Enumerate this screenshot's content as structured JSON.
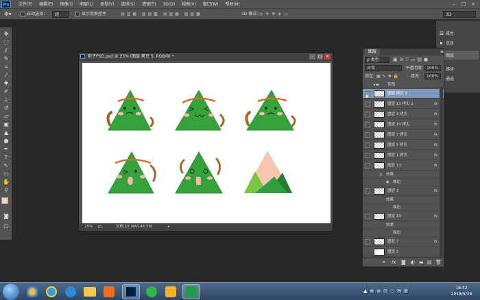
{
  "menubar": {
    "app_logo": "Ps",
    "menus": [
      "文件(F)",
      "编辑(E)",
      "图像(I)",
      "图层(L)",
      "类型(Y)",
      "选择(S)",
      "滤镜(T)",
      "3D(D)",
      "视图(V)",
      "窗口(W)",
      "帮助(H)"
    ]
  },
  "options": {
    "auto_select_label": "自动选择：",
    "auto_select_value": "组",
    "show_transform_label": "显示变换控件",
    "mode_3d_label": "3D 模式：",
    "workspace": "3D"
  },
  "document": {
    "title": "粽子PSD.psd @ 25% (图层 拷贝 5, RGB/8) *",
    "zoom": "25%",
    "doc_info": "文档:16.9M/146.5M"
  },
  "right_panel": {
    "items": [
      {
        "icon": "properties-icon",
        "label": "属性"
      },
      {
        "icon": "info-icon",
        "label": "信息"
      },
      {
        "icon": "layers-icon",
        "label": "图层"
      },
      {
        "icon": "paths-icon",
        "label": "路径"
      },
      {
        "icon": "channels-icon",
        "label": "通道"
      }
    ]
  },
  "layers": {
    "tab": "图层",
    "filter": "类型",
    "blend_mode": "正常",
    "opacity_label": "不透明度：",
    "opacity": "100%",
    "lock_label": "锁定：",
    "fill_label": "填充：",
    "fill": "100%",
    "group_name": "草图",
    "rows": [
      {
        "name": "图层 拷贝 5",
        "selected": true,
        "fx": ""
      },
      {
        "name": "图层 13 拷贝 2",
        "selected": false,
        "fx": "fx"
      },
      {
        "name": "图层 3 拷贝",
        "selected": false,
        "fx": "fx"
      },
      {
        "name": "图层 10 拷贝",
        "selected": false,
        "fx": "fx"
      },
      {
        "name": "图层 7 拷贝",
        "selected": false,
        "fx": "fx"
      },
      {
        "name": "图层 5 拷贝",
        "selected": false,
        "fx": "fx"
      },
      {
        "name": "图层 1 拷贝",
        "selected": false,
        "fx": "fx"
      },
      {
        "name": "图层 13",
        "selected": false,
        "fx": "fx"
      }
    ],
    "effects_label": "效果",
    "stroke_label": "描边",
    "lower_layers": [
      "图层 3",
      "图层 10",
      "图层 7",
      "图层 5"
    ]
  },
  "taskbar": {
    "time": "16:42",
    "date": "2018/5/28"
  }
}
